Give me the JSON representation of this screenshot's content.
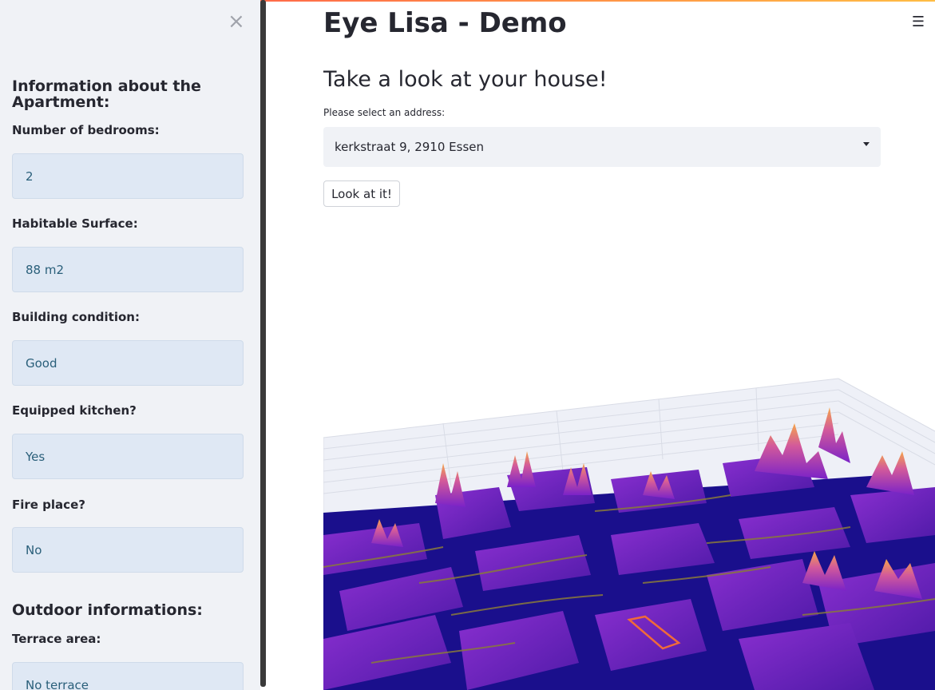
{
  "sidebar": {
    "close_icon": "close-icon",
    "apartment_heading": "Information about the Apartment:",
    "fields": [
      {
        "label": "Number of bedrooms:",
        "value": "2"
      },
      {
        "label": "Habitable Surface:",
        "value": "88 m2"
      },
      {
        "label": "Building condition:",
        "value": "Good"
      },
      {
        "label": "Equipped kitchen?",
        "value": "Yes"
      },
      {
        "label": "Fire place?",
        "value": "No"
      }
    ],
    "outdoor_heading": "Outdoor informations:",
    "outdoor_fields": [
      {
        "label": "Terrace area:",
        "value": "No terrace"
      }
    ]
  },
  "main": {
    "title": "Eye Lisa - Demo",
    "menu_icon": "hamburger-menu-icon",
    "subheader": "Take a look at your house!",
    "select": {
      "label": "Please select an address:",
      "value": "kerkstraat 9, 2910 Essen"
    },
    "button_label": "Look at it!"
  },
  "colors": {
    "accent": "#ff4b4b",
    "sidebar_bg": "#f0f2f6",
    "field_bg": "#dfe8f4",
    "plot_floor": "#1a0f8c",
    "plot_building": "#6a1fc2",
    "plot_peak": "#f6a64a"
  }
}
